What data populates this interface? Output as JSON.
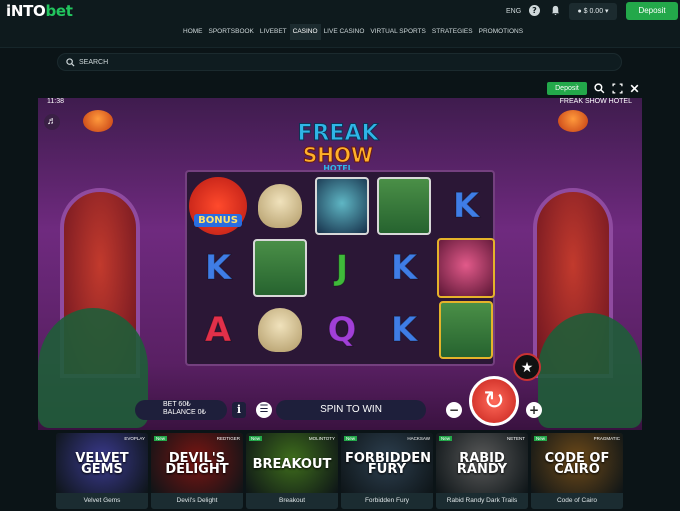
{
  "header": {
    "logo_left": "iNTO",
    "logo_right": "bet",
    "lang": "ENG",
    "help": "?",
    "balance": "$ 0.00",
    "deposit": "Deposit"
  },
  "nav": [
    "HOME",
    "SPORTSBOOK",
    "LIVEBET",
    "CASINO",
    "LIVE CASINO",
    "VIRTUAL SPORTS",
    "STRATEGIES",
    "PROMOTIONS"
  ],
  "search": {
    "placeholder": "SEARCH"
  },
  "game_bar": {
    "deposit": "Deposit"
  },
  "game": {
    "time": "11:38",
    "title": "FREAK SHOW HOTEL",
    "logo_line1": "FREAK",
    "logo_line2": "SHOW",
    "logo_line3": "HOTEL",
    "bonus_label": "BONUS",
    "bet": "BET 60₺",
    "balance": "BALANCE 0₺",
    "info": "i",
    "spin_text": "SPIN TO WIN",
    "minus": "−",
    "plus": "+"
  },
  "thumbnails": [
    {
      "title": "VELVET GEMS",
      "name": "Velvet Gems",
      "provider": "EVOPLAY",
      "new": "",
      "color": "#3b3a8f"
    },
    {
      "title": "DEVIL'S DELIGHT",
      "name": "Devil's Delight",
      "provider": "REDTIGER",
      "new": "New",
      "color": "#7a1512"
    },
    {
      "title": "BREAKOUT",
      "name": "Breakout",
      "provider": "MOLINTOTY",
      "new": "New",
      "color": "#3f6e1c"
    },
    {
      "title": "FORBIDDEN FURY",
      "name": "Forbidden Fury",
      "provider": "HACKSAW",
      "new": "New",
      "color": "#2d3f4f"
    },
    {
      "title": "RABID RANDY",
      "name": "Rabid Randy Dark Trails",
      "provider": "NETENT",
      "new": "New",
      "color": "#5a5a5a"
    },
    {
      "title": "CODE OF CAIRO",
      "name": "Code of Cairo",
      "provider": "PRAGMATIC",
      "new": "New",
      "color": "#6e4a18"
    }
  ]
}
